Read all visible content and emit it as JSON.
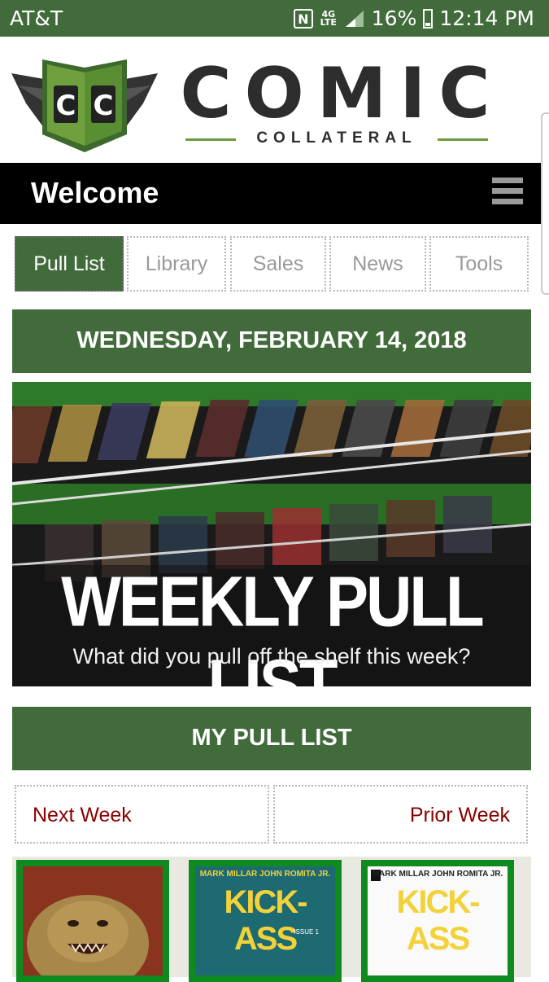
{
  "status_bar": {
    "carrier": "AT&T",
    "nfc_icon": "N",
    "network": "4G LTE",
    "battery": "16%",
    "time": "12:14 PM"
  },
  "logo": {
    "mark": "CC",
    "title": "COMIC",
    "subtitle": "COLLATERAL"
  },
  "header": {
    "welcome": "Welcome"
  },
  "tabs": [
    {
      "label": "Pull List",
      "active": true
    },
    {
      "label": "Library",
      "active": false
    },
    {
      "label": "Sales",
      "active": false
    },
    {
      "label": "News",
      "active": false
    },
    {
      "label": "Tools",
      "active": false
    }
  ],
  "date_header": "WEDNESDAY, FEBRUARY 14, 2018",
  "banner": {
    "title": "WEEKLY PULL LIST",
    "subtitle": "What did you pull off the shelf this week?"
  },
  "pull_list_header": "MY PULL LIST",
  "week_nav": {
    "next": "Next Week",
    "prior": "Prior Week"
  },
  "comics": [
    {
      "credit": "",
      "title": ""
    },
    {
      "credit": "MARK MILLAR  JOHN ROMITA JR.",
      "title": "KICK-ASS",
      "issue": "ISSUE 1"
    },
    {
      "credit": "MARK MILLAR  JOHN ROMITA JR.",
      "title": "KICK-ASS"
    }
  ],
  "colors": {
    "brand_green": "#426b3b",
    "link_red": "#8b0000"
  }
}
